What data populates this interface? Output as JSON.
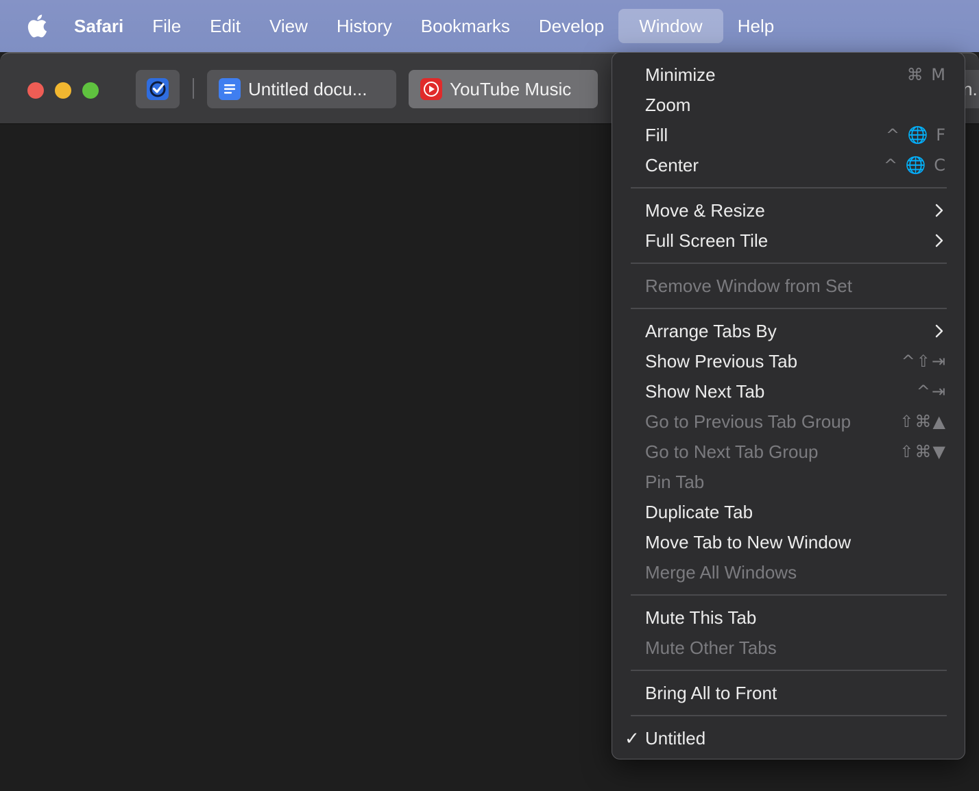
{
  "menubar": {
    "apple_icon": "apple-logo-icon",
    "app_name": "Safari",
    "items": [
      "File",
      "Edit",
      "View",
      "History",
      "Bookmarks",
      "Develop",
      "Window",
      "Help"
    ],
    "active_item": "Window",
    "background_color": "#8593c6"
  },
  "toolbar": {
    "traffic_lights": {
      "close": "#ee5d55",
      "minimize": "#f2b730",
      "zoom": "#5fc23f"
    },
    "tab_group_icon": "checkmark-circle-icon",
    "tabs": [
      {
        "title": "Untitled docu...",
        "favicon": "google-docs-icon"
      },
      {
        "title": "YouTube Music",
        "favicon": "youtube-music-icon",
        "active": true
      },
      {
        "title": "n..."
      }
    ]
  },
  "window_menu": {
    "items": {
      "minimize": {
        "label": "Minimize",
        "shortcut": "⌘ M"
      },
      "zoom": {
        "label": "Zoom"
      },
      "fill": {
        "label": "Fill",
        "shortcut": "^ 🌐 F"
      },
      "center": {
        "label": "Center",
        "shortcut": "^ 🌐 C"
      },
      "move_resize": {
        "label": "Move & Resize",
        "submenu": true
      },
      "full_screen_tile": {
        "label": "Full Screen Tile",
        "submenu": true
      },
      "remove_window": {
        "label": "Remove Window from Set",
        "disabled": true
      },
      "arrange_tabs": {
        "label": "Arrange Tabs By",
        "submenu": true
      },
      "show_prev_tab": {
        "label": "Show Previous Tab",
        "shortcut": "^⇧⇥"
      },
      "show_next_tab": {
        "label": "Show Next Tab",
        "shortcut": "^⇥"
      },
      "go_prev_group": {
        "label": "Go to Previous Tab Group",
        "shortcut": "⇧⌘▲",
        "disabled": true
      },
      "go_next_group": {
        "label": "Go to Next Tab Group",
        "shortcut": "⇧⌘▼",
        "disabled": true
      },
      "pin_tab": {
        "label": "Pin Tab",
        "disabled": true
      },
      "duplicate_tab": {
        "label": "Duplicate Tab"
      },
      "move_tab_new_window": {
        "label": "Move Tab to New Window"
      },
      "merge_windows": {
        "label": "Merge All Windows",
        "disabled": true
      },
      "mute_tab": {
        "label": "Mute This Tab"
      },
      "mute_other_tabs": {
        "label": "Mute Other Tabs",
        "disabled": true
      },
      "bring_all_front": {
        "label": "Bring All to Front"
      },
      "untitled": {
        "label": "Untitled",
        "checked": true,
        "check": "✓"
      }
    }
  }
}
